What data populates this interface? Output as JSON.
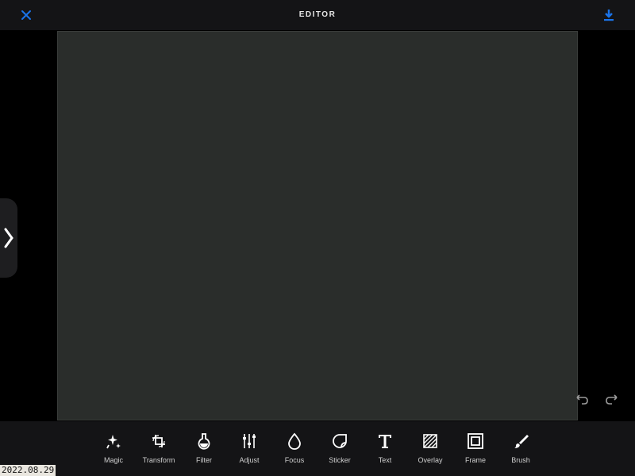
{
  "header": {
    "title": "EDITOR",
    "close_icon": "close-icon",
    "download_icon": "download-icon",
    "accent_color": "#1a73e8"
  },
  "canvas": {
    "side_panel_icon": "chevron-right-icon",
    "undo_icon": "undo-icon",
    "redo_icon": "redo-icon"
  },
  "toolbar": {
    "tools": [
      {
        "label": "Magic",
        "icon": "magic-wand-icon"
      },
      {
        "label": "Transform",
        "icon": "crop-rotate-icon"
      },
      {
        "label": "Filter",
        "icon": "filter-flask-icon"
      },
      {
        "label": "Adjust",
        "icon": "sliders-icon"
      },
      {
        "label": "Focus",
        "icon": "drop-icon"
      },
      {
        "label": "Sticker",
        "icon": "sticker-icon"
      },
      {
        "label": "Text",
        "icon": "text-icon"
      },
      {
        "label": "Overlay",
        "icon": "overlay-icon"
      },
      {
        "label": "Frame",
        "icon": "frame-icon"
      },
      {
        "label": "Brush",
        "icon": "brush-icon"
      }
    ]
  },
  "date_stamp": "2022.08.29"
}
